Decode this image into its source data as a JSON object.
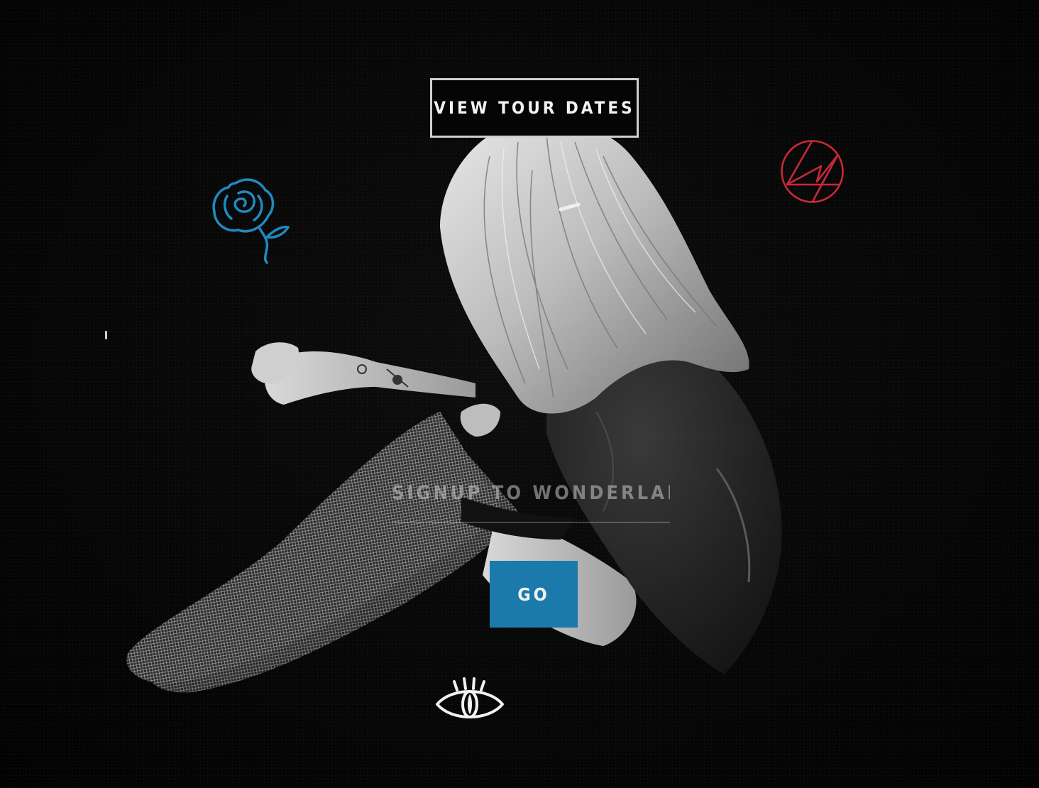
{
  "header": {
    "tour_button_label": "VIEW TOUR DATES"
  },
  "signup": {
    "placeholder": "SIGNUP TO WONDERLAND",
    "value": "",
    "submit_label": "GO"
  },
  "icons": {
    "rose": "rose-icon",
    "sigil": "sigil-icon",
    "eye": "eye-icon"
  },
  "colors": {
    "background": "#060606",
    "accent_blue": "#1b7aab",
    "rose_blue": "#1f8ac0",
    "sigil_red": "#c8283a",
    "button_border": "#cfcfcf",
    "text": "#f2f2f2"
  }
}
